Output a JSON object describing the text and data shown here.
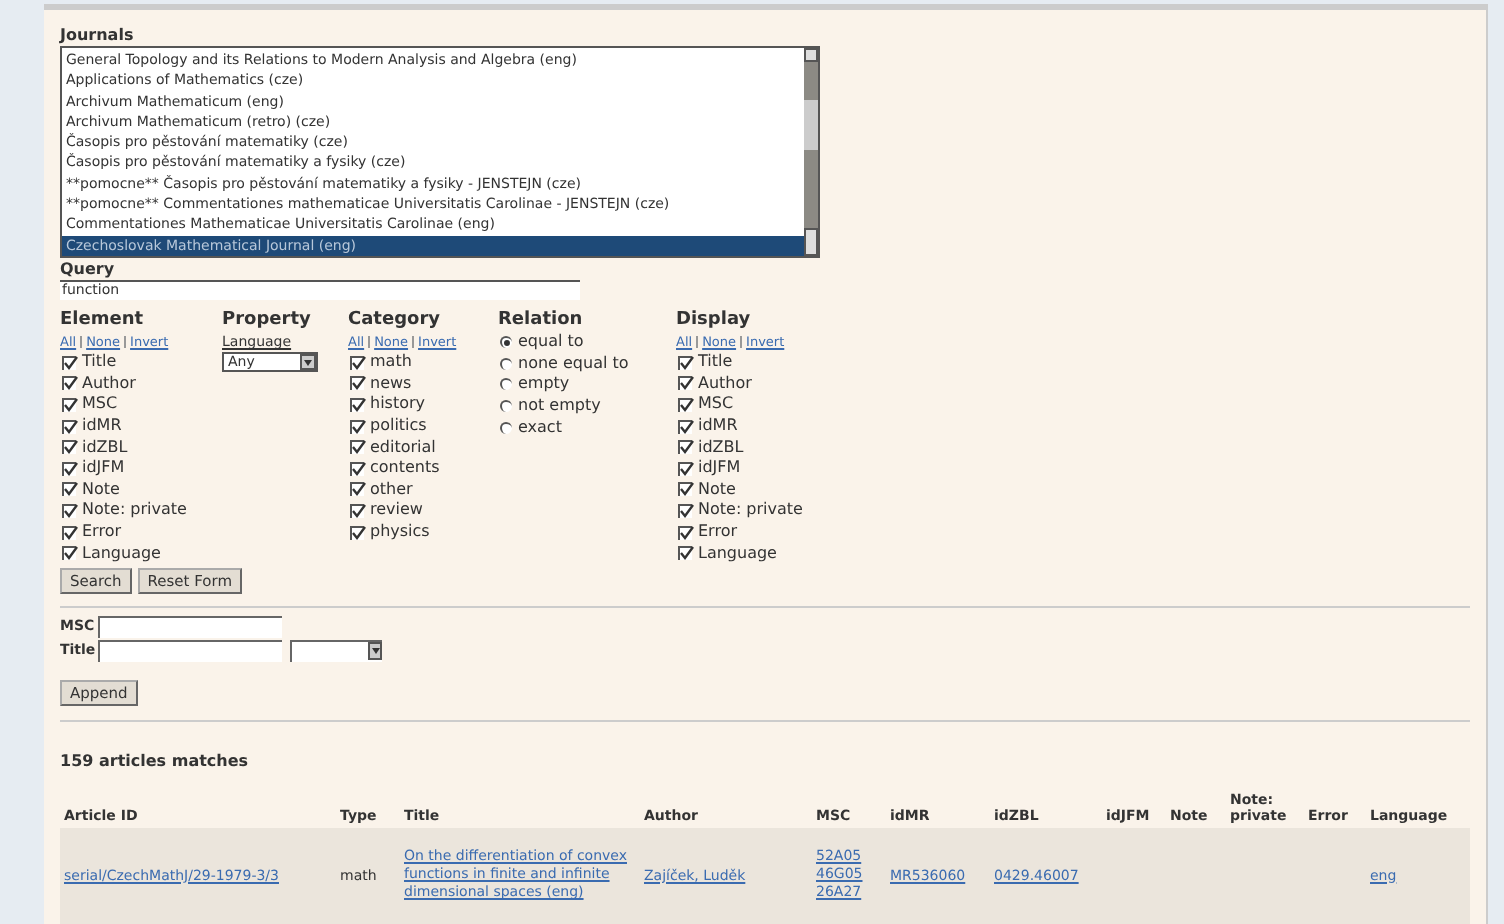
{
  "journals": {
    "label": "Journals",
    "items": [
      {
        "name": "General Topology and its Relations to Modern Analysis and Algebra (eng)",
        "selected": false
      },
      {
        "name": "Applications of Mathematics (cze)",
        "selected": false
      },
      {
        "name": "Archivum Mathematicum (eng)",
        "selected": false
      },
      {
        "name": "Archivum Mathematicum (retro) (cze)",
        "selected": false
      },
      {
        "name": "Časopis pro pěstování matematiky (cze)",
        "selected": false
      },
      {
        "name": "Časopis pro pěstování matematiky a fysiky (cze)",
        "selected": false
      },
      {
        "name": "**pomocne** Časopis pro pěstování matematiky a fysiky - JENSTEJN (cze)",
        "selected": false
      },
      {
        "name": "**pomocne** Commentationes mathematicae Universitatis Carolinae - JENSTEJN (cze)",
        "selected": false
      },
      {
        "name": "Commentationes Mathematicae Universitatis Carolinae (eng)",
        "selected": false
      },
      {
        "name": "Czechoslovak Mathematical Journal (eng)",
        "selected": true
      }
    ]
  },
  "query": {
    "label": "Query",
    "value": "function"
  },
  "element": {
    "heading": "Element",
    "links": [
      "All",
      "None",
      "Invert"
    ],
    "items": [
      {
        "label": "Title",
        "checked": true
      },
      {
        "label": "Author",
        "checked": true
      },
      {
        "label": "MSC",
        "checked": true
      },
      {
        "label": "idMR",
        "checked": true
      },
      {
        "label": "idZBL",
        "checked": true
      },
      {
        "label": "idJFM",
        "checked": true
      },
      {
        "label": "Note",
        "checked": true
      },
      {
        "label": "Note: private",
        "checked": true
      },
      {
        "label": "Error",
        "checked": true
      },
      {
        "label": "Language",
        "checked": true
      }
    ]
  },
  "property": {
    "heading": "Property",
    "label": "Language",
    "value": "Any"
  },
  "category": {
    "heading": "Category",
    "links": [
      "All",
      "None",
      "Invert"
    ],
    "items": [
      {
        "label": "math",
        "checked": true
      },
      {
        "label": "news",
        "checked": true
      },
      {
        "label": "history",
        "checked": true
      },
      {
        "label": "politics",
        "checked": true
      },
      {
        "label": "editorial",
        "checked": true
      },
      {
        "label": "contents",
        "checked": true
      },
      {
        "label": "other",
        "checked": true
      },
      {
        "label": "review",
        "checked": true
      },
      {
        "label": "physics",
        "checked": true
      }
    ]
  },
  "relation": {
    "heading": "Relation",
    "options": [
      {
        "label": "equal to",
        "selected": true
      },
      {
        "label": "none equal to",
        "selected": false
      },
      {
        "label": "empty",
        "selected": false
      },
      {
        "label": "not empty",
        "selected": false
      },
      {
        "label": "exact",
        "selected": false
      }
    ]
  },
  "display": {
    "heading": "Display",
    "links": [
      "All",
      "None",
      "Invert"
    ],
    "items": [
      {
        "label": "Title",
        "checked": true
      },
      {
        "label": "Author",
        "checked": true
      },
      {
        "label": "MSC",
        "checked": true
      },
      {
        "label": "idMR",
        "checked": true
      },
      {
        "label": "idZBL",
        "checked": true
      },
      {
        "label": "idJFM",
        "checked": true
      },
      {
        "label": "Note",
        "checked": true
      },
      {
        "label": "Note: private",
        "checked": true
      },
      {
        "label": "Error",
        "checked": true
      },
      {
        "label": "Language",
        "checked": true
      }
    ]
  },
  "buttons": [
    "Search",
    "Reset Form"
  ],
  "append_form": {
    "msc_label": "MSC",
    "title_label": "Title",
    "button": "Append"
  },
  "results": {
    "count": "159 articles matches",
    "columns": [
      "Article ID",
      "Type",
      "Title",
      "Author",
      "MSC",
      "idMR",
      "idZBL",
      "idJFM",
      "Note",
      "Note: private",
      "Error",
      "Language"
    ],
    "rows": [
      {
        "article_id": "serial/CzechMathJ/29-1979-3/3",
        "type": "math",
        "title": "On the differentiation of convex functions in finite and infinite dimensional spaces (eng)",
        "author": "Zajíček, Luděk",
        "msc": [
          "52A05",
          "46G05",
          "26A27"
        ],
        "idmr": "MR536060",
        "idzbl": "0429.46007",
        "idjfm": "",
        "note": "",
        "note_private": "",
        "error": "",
        "language": "eng"
      }
    ]
  }
}
